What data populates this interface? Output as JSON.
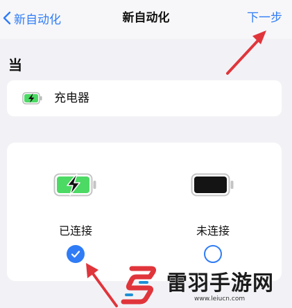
{
  "navbar": {
    "back_label": "新自动化",
    "title": "新自动化",
    "next_label": "下一步"
  },
  "section": {
    "label": "当"
  },
  "trigger": {
    "label": "充电器",
    "icon": "battery-charging-icon"
  },
  "options": [
    {
      "label": "已连接",
      "icon": "battery-charging-large-icon",
      "selected": true
    },
    {
      "label": "未连接",
      "icon": "battery-full-dark-icon",
      "selected": false
    }
  ],
  "watermark": {
    "brand": "雷羽手游网",
    "url": "www.leiucn.com"
  },
  "colors": {
    "accent": "#2f7cf6",
    "annotation_arrow": "#e0353b",
    "battery_green": "#4cd964"
  }
}
